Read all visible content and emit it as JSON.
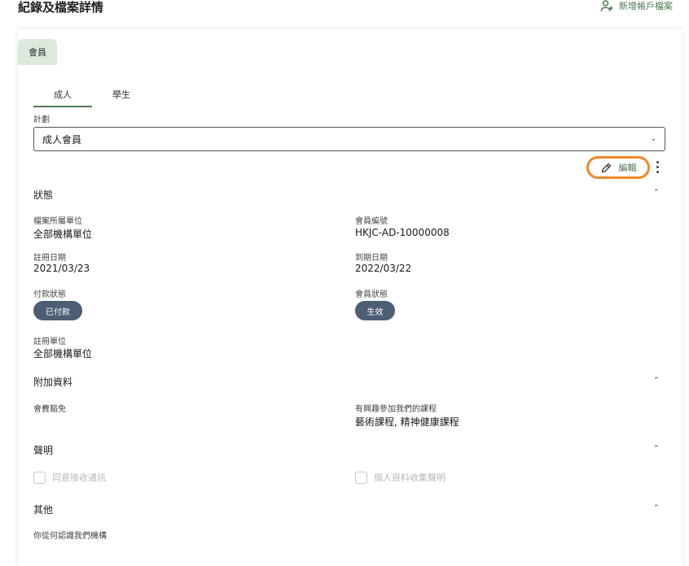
{
  "header": {
    "title": "紀錄及檔案詳情",
    "add_account_label": "新增帳戶檔案"
  },
  "tabs": {
    "member": "會員"
  },
  "subtabs": [
    "成人",
    "學生"
  ],
  "plan": {
    "label": "計劃",
    "value": "成人會員"
  },
  "actions": {
    "edit_label": "編輯"
  },
  "status_section": {
    "title": "狀態",
    "profile_unit_label": "檔案所屬單位",
    "profile_unit_value": "全部機構單位",
    "member_no_label": "會員編號",
    "member_no_value": "HKJC-AD-10000008",
    "reg_date_label": "註冊日期",
    "reg_date_value": "2021/03/23",
    "expiry_label": "到期日期",
    "expiry_value": "2022/03/22",
    "payment_label": "付款狀態",
    "payment_value": "已付款",
    "member_status_label": "會員狀態",
    "member_status_value": "生效",
    "reg_unit_label": "註冊單位",
    "reg_unit_value": "全部機構單位"
  },
  "extra_section": {
    "title": "附加資料",
    "fee_label": "會費豁免",
    "courses_label": "有興趣參加我們的課程",
    "courses_value": "藝術課程, 精神健康課程"
  },
  "declaration_section": {
    "title": "聲明",
    "consent_label": "同意接收通訊",
    "privacy_label": "個人資料收集聲明"
  },
  "other_section": {
    "title": "其他",
    "source_label": "你從何認識我們機構"
  },
  "colors": {
    "accent": "#4f7a52",
    "highlight": "#f0882a",
    "pill": "#4d5d74",
    "tab_bg": "#dce9dc"
  }
}
